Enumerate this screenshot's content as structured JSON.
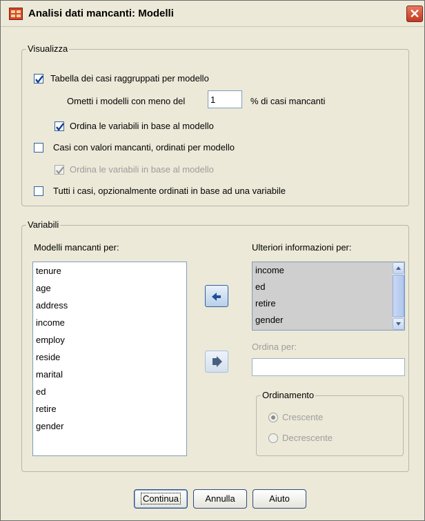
{
  "window": {
    "title": "Analisi dati mancanti: Modelli",
    "close_label": "✕"
  },
  "visualizza": {
    "legend": "Visualizza",
    "opt1": {
      "label": "Tabella dei casi raggruppati per modello",
      "checked": true
    },
    "omit": {
      "prefix": "Ometti i modelli con meno del",
      "value": "1",
      "suffix": "% di casi mancanti"
    },
    "sort1": {
      "label": "Ordina le variabili in base al modello",
      "checked": true
    },
    "opt2": {
      "label": "Casi con valori mancanti, ordinati per modello",
      "checked": false
    },
    "sort2": {
      "label": "Ordina le variabili in base al modello",
      "checked": true,
      "disabled": true
    },
    "opt3": {
      "label": "Tutti i casi, opzionalmente ordinati in base ad una variabile",
      "checked": false
    }
  },
  "variabili": {
    "legend": "Variabili",
    "left_label": "Modelli mancanti per:",
    "left_items": [
      "tenure",
      "age",
      "address",
      "income",
      "employ",
      "reside",
      "marital",
      "ed",
      "retire",
      "gender"
    ],
    "right_label": "Ulteriori informazioni per:",
    "right_items": [
      "income",
      "ed",
      "retire",
      "gender"
    ],
    "sort_by_label": "Ordina per:",
    "sort_by_value": "",
    "ordering": {
      "legend": "Ordinamento",
      "asc": "Crescente",
      "desc": "Decrescente",
      "selected": "Crescente"
    }
  },
  "buttons": {
    "continue": "Continua",
    "cancel": "Annulla",
    "help": "Aiuto"
  },
  "colors": {
    "dialog_bg": "#ece9d8",
    "accent": "#2c5f9e",
    "selection": "#cfcfcf"
  }
}
